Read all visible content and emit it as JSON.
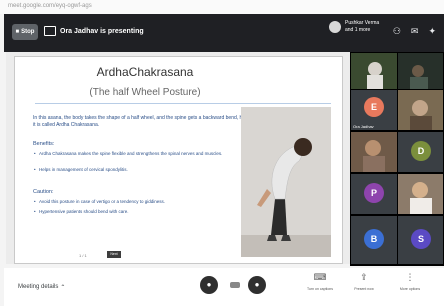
{
  "window": {
    "tab_text": "meet.google.com/eyq-ogwf-ags"
  },
  "header": {
    "stop_label": "Stop",
    "presenter_text": "Ora Jadhav is presenting",
    "pinned_line1": "Pushkar Verma",
    "pinned_line2": "and 1 more"
  },
  "slide": {
    "title": "ArdhaChakrasana",
    "subtitle": "(The half Wheel Posture)",
    "intro": "In this asana, the body takes the shape of a half wheel, and the spine gets a backward bend, hence it is called Ardha Chakrasana.",
    "benefits_heading": "Benefits:",
    "benefits": [
      "Ardha Chakrasana makes the spine flexible and strengthens the spinal nerves and muscles.",
      "Helps in management of cervical spondylitis."
    ],
    "caution_heading": "Caution:",
    "cautions": [
      "Avoid this posture in case of vertigo or a tendency to giddiness.",
      "Hypertensive patients should bend with care."
    ],
    "pager": "1 / 1",
    "tag": "Next"
  },
  "participants": [
    {
      "name": "",
      "initial": "",
      "kind": "video",
      "bg": "#3a4a30"
    },
    {
      "name": "",
      "initial": "",
      "kind": "video",
      "bg": "#27302a"
    },
    {
      "name": "Ora Jadhav",
      "initial": "E",
      "kind": "avatar",
      "color": "#e8795d"
    },
    {
      "name": "",
      "initial": "",
      "kind": "video",
      "bg": "#7a6a52"
    },
    {
      "name": "",
      "initial": "",
      "kind": "video",
      "bg": "#6f5a48"
    },
    {
      "name": "",
      "initial": "D",
      "kind": "avatar",
      "color": "#7b8f3c"
    },
    {
      "name": "",
      "initial": "P",
      "kind": "avatar",
      "color": "#8e44ad"
    },
    {
      "name": "",
      "initial": "",
      "kind": "video",
      "bg": "#8c7b6a"
    },
    {
      "name": "",
      "initial": "B",
      "kind": "avatar",
      "color": "#3b6fd4"
    },
    {
      "name": "",
      "initial": "S",
      "kind": "avatar",
      "color": "#5b4ac4"
    }
  ],
  "bottom": {
    "meeting_details": "Meeting details",
    "captions_label": "Turn on captions",
    "present_label": "Present now",
    "more_label": "More options"
  },
  "icons": {
    "mic": "mic-icon",
    "camera": "camera-icon",
    "end": "end-call-icon",
    "captions": "captions-icon",
    "present": "present-icon",
    "more": "more-icon"
  }
}
